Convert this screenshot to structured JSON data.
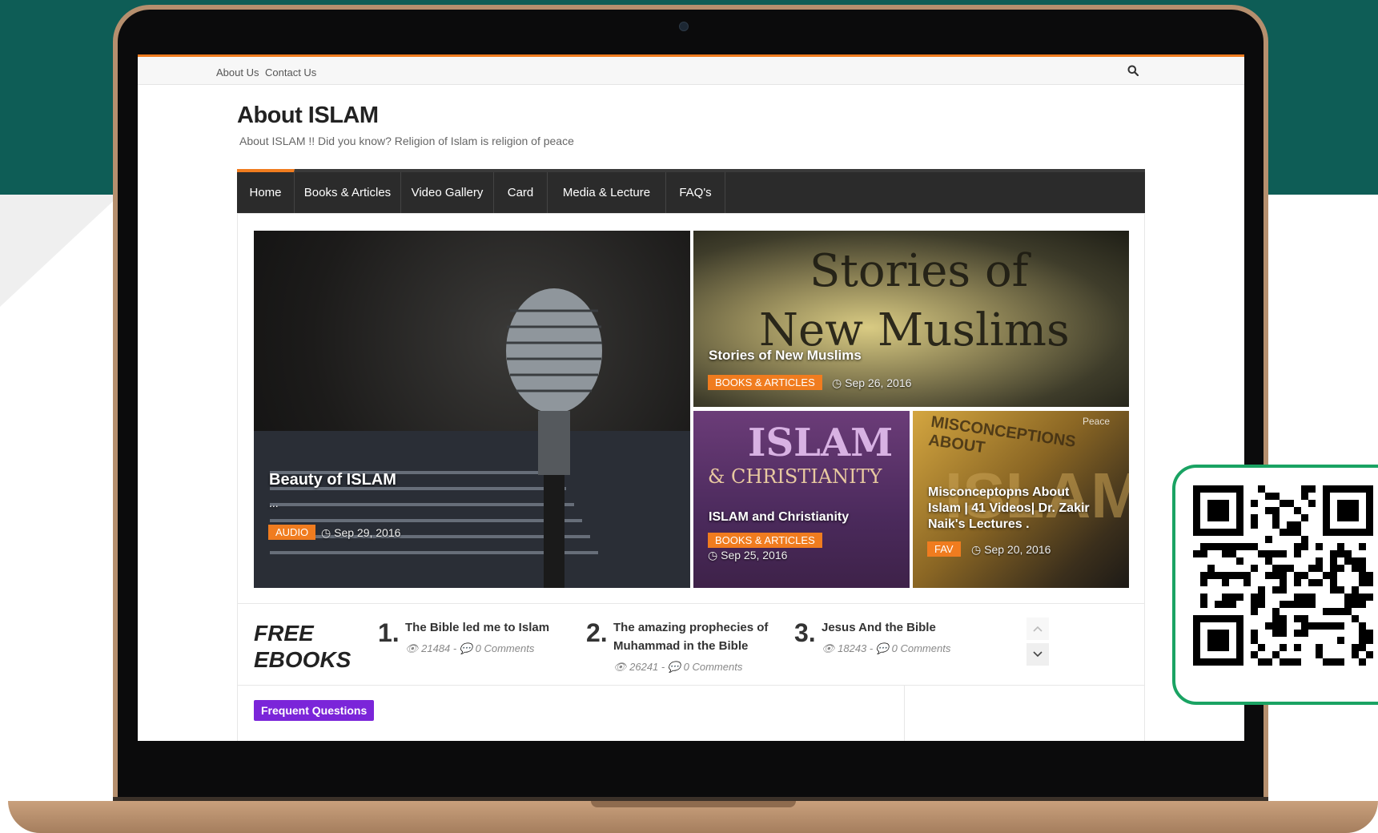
{
  "colors": {
    "accent": "#f07c1f",
    "teal": "#0e5d56",
    "nav_bg": "#2b2b2b",
    "faq_badge": "#7b25d9",
    "qr_border": "#1aa363"
  },
  "topbar": {
    "links": [
      "About Us",
      "Contact Us"
    ],
    "search_icon": "search-icon"
  },
  "site": {
    "title": "About ISLAM",
    "tagline": "About ISLAM !! Did you know? Religion of Islam is religion of peace"
  },
  "nav": {
    "items": [
      "Home",
      "Books & Articles",
      "Video Gallery",
      "Card",
      "Media & Lecture",
      "FAQ's"
    ],
    "active": "Home"
  },
  "slider": [
    {
      "title": "Beauty of ISLAM",
      "excerpt": "...",
      "category": "AUDIO",
      "date": "Sep 29, 2016"
    },
    {
      "title": "Stories of New Muslims",
      "image_text": [
        "Stories of",
        "New Muslims"
      ],
      "category": "BOOKS & ARTICLES",
      "date": "Sep 26, 2016"
    },
    {
      "title": "ISLAM and Christianity",
      "image_text": [
        "ISLAM",
        "& CHRISTIANITY"
      ],
      "category": "BOOKS & ARTICLES",
      "date": "Sep 25, 2016"
    },
    {
      "title": "Misconceptopns About Islam | 41 Videos| Dr. Zakir Naik's Lectures .",
      "image_text": [
        "MISCONCEPTIONS ABOUT",
        "ISLAM",
        "Peace"
      ],
      "category": "FAV",
      "date": "Sep 20, 2016"
    }
  ],
  "ebooks": {
    "title_line1": "FREE",
    "title_line2": "EBOOKS",
    "items": [
      {
        "num": "1.",
        "title": "The Bible led me to Islam",
        "views": "21484",
        "comments": "0 Comments"
      },
      {
        "num": "2.",
        "title": "The amazing prophecies of Muhammad in the Bible",
        "views": "26241",
        "comments": "0 Comments"
      },
      {
        "num": "3.",
        "title": "Jesus And the Bible",
        "views": "18243",
        "comments": "0 Comments"
      }
    ]
  },
  "faq": {
    "label": "Frequent Questions"
  }
}
